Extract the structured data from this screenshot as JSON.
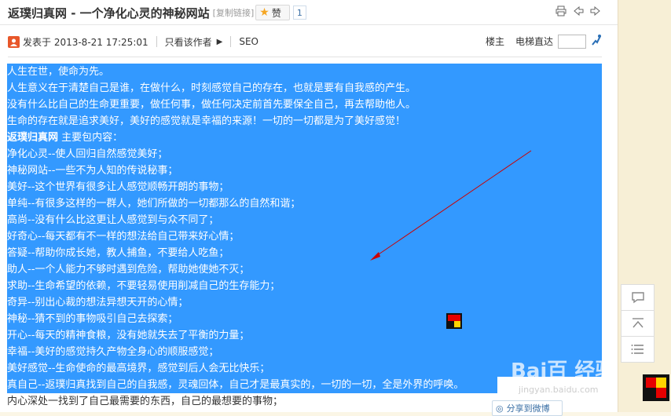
{
  "header": {
    "title": "返璞归真网 - 一个净化心灵的神秘网站",
    "copy_link": "[复制链接]",
    "like_label": "赞",
    "like_count": "1"
  },
  "meta": {
    "posted": "发表于 2013-8-21 17:25:01",
    "only_author": "只看该作者",
    "category": "SEO",
    "floor": "楼主",
    "elevator": "电梯直达"
  },
  "content": {
    "lines": [
      "人生在世，使命为先。",
      "人生意义在于清楚自己是谁，在做什么，时刻感觉自己的存在，也就是要有自我感的产生。",
      "没有什么比自己的生命更重要，做任何事，做任何决定前首先要保全自己，再去帮助他人。",
      "生命的存在就是追求美好，美好的感觉就是幸福的来源！一切的一切都是为了美好感觉！",
      "返璞归真网 主要包内容：",
      "净化心灵--使人回归自然感觉美好；",
      "神秘网站--一些不为人知的传说秘事；",
      "美好--这个世界有很多让人感觉顺畅开朗的事物；",
      "单纯--有很多这样的一群人，她们所做的一切都那么的自然和谐；",
      "高尚--没有什么比这更让人感觉到与众不同了；",
      "好奇心--每天都有不一样的想法给自己带来好心情；",
      "答疑--帮助你成长她，教人捕鱼，不要给人吃鱼；",
      "助人--一个人能力不够时遇到危险，帮助她使她不灭；",
      "求助--生命希望的依赖，不要轻易使用削减自己的生存能力；",
      "奇异--别出心裁的想法异想天开的心情；",
      "神秘--猜不到的事物吸引自己去探索；",
      "开心--每天的精神食粮，没有她就失去了平衡的力量；",
      "幸福--美好的感觉持久产物全身心的顺服感觉；",
      "美好感觉--生命使命的最高境界，感觉到后人会无比快乐；",
      "真自己--返璞归真找到自己的自我感，灵魂回体，自己才是最真实的，一切的一切，全是外界的呼唤。",
      "内心深处一找到了自己最需要的东西，自己的最想要的事物；"
    ],
    "bold_prefix": "返璞归真网"
  },
  "share": {
    "weibo": "分享到微博"
  },
  "watermark": {
    "brand": "Bai百 经验",
    "url": "jingyan.baidu.com"
  },
  "colors": {
    "selection": "#3399ff",
    "arrow": "#cc0000"
  }
}
